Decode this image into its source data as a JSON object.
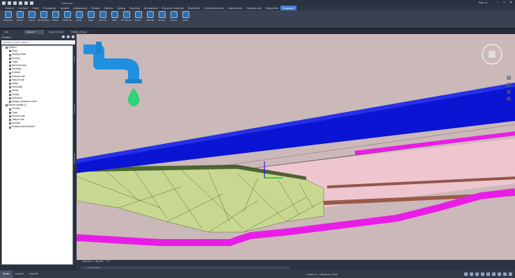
{
  "window": {
    "title": "Autodesk",
    "user": "Sign In"
  },
  "ribbon": {
    "tabs": [
      "Soubor",
      "Výchozí",
      "Vložit",
      "Poznámky",
      "Upravit",
      "Analyzovat",
      "Pohled",
      "Správa",
      "Výstup",
      "Doplňky",
      "Spolupráce",
      "Expresní nástroje",
      "Rozšíření",
      "Společný model",
      "Navrhování",
      "Správce dat",
      "Nápověda",
      "Snapshot"
    ],
    "active_tab": "Snapshot",
    "buttons": [
      "Vlastnosti",
      "Export",
      "Import",
      "3D Prohlížeč",
      "Pohled",
      "Vlastnosti",
      "Profily",
      "Body",
      "Povrchy",
      "Klíče",
      "3D Výchozí",
      "Export",
      "Nástroje",
      "Snímky",
      "Úpravy",
      "Sdílet"
    ],
    "panels": [
      "Data",
      "Kontext",
      "Pohled",
      "Povrchy",
      "Export",
      "Snímky"
    ]
  },
  "doc_tabs": [
    "Start",
    "Výkres1*",
    "Projekt_01.dwg*",
    "MODEL_01.dwg"
  ],
  "doc_active": 1,
  "left_panel": {
    "title": "Prostor",
    "search_placeholder": "Vyhledat v prostoru výkresu",
    "tree": [
      {
        "indent": 0,
        "exp": "−",
        "label": "Výkres1"
      },
      {
        "indent": 1,
        "exp": "",
        "label": "Body"
      },
      {
        "indent": 1,
        "exp": "",
        "label": "Skupiny bodů"
      },
      {
        "indent": 1,
        "exp": "",
        "label": "Povrchy"
      },
      {
        "indent": 1,
        "exp": "+",
        "label": "Trasy"
      },
      {
        "indent": 1,
        "exp": "",
        "label": "Návrhové linie"
      },
      {
        "indent": 1,
        "exp": "+",
        "label": "Pozemky"
      },
      {
        "indent": 1,
        "exp": "",
        "label": "Koridory"
      },
      {
        "indent": 1,
        "exp": "",
        "label": "Potrubní sítě"
      },
      {
        "indent": 1,
        "exp": "",
        "label": "Tlakové sítě"
      },
      {
        "indent": 1,
        "exp": "",
        "label": "Mosty"
      },
      {
        "indent": 1,
        "exp": "",
        "label": "Křižovatky"
      },
      {
        "indent": 1,
        "exp": "",
        "label": "Terény"
      },
      {
        "indent": 1,
        "exp": "",
        "label": "Kanály"
      },
      {
        "indent": 1,
        "exp": "+",
        "label": "Zobrazení"
      },
      {
        "indent": 1,
        "exp": "",
        "label": "Skupiny sledování změn"
      },
      {
        "indent": 0,
        "exp": "−",
        "label": "Datové zkratky [-]"
      },
      {
        "indent": 1,
        "exp": "",
        "label": "Povrchy"
      },
      {
        "indent": 1,
        "exp": "+",
        "label": "Trasy"
      },
      {
        "indent": 1,
        "exp": "",
        "label": "Potrubní sítě"
      },
      {
        "indent": 1,
        "exp": "",
        "label": "Tlakové sítě"
      },
      {
        "indent": 1,
        "exp": "",
        "label": "Koridory"
      },
      {
        "indent": 1,
        "exp": "",
        "label": "Skupiny návrhů sklonů"
      }
    ],
    "vertical_labels": [
      "Prostor",
      "Nastavení",
      "Vyhledávání"
    ]
  },
  "command": {
    "history": "Vybráno 1 objekt.   ***",
    "placeholder": "Zadejte příkaz"
  },
  "status": {
    "layout_tabs": [
      "Model",
      "Layout1",
      "Layout2"
    ],
    "active_layout": 0,
    "coords": "1038870.72, -1066948.05, 0.0000",
    "mode": "MODEL"
  },
  "colors": {
    "viewport_bg": "#cbb8b8",
    "blue_pipe": "#0a14d2",
    "magenta_pipe": "#e81ee6",
    "terrain": "#c8d890",
    "faucet_blue": "#1f8fe0",
    "drop_green": "#2fd37a",
    "accent": "#3b7fd1"
  }
}
